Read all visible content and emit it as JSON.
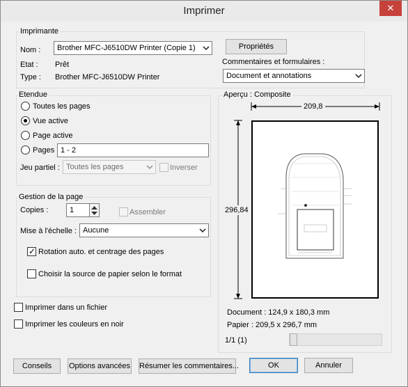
{
  "window": {
    "title": "Imprimer",
    "close_glyph": "✕"
  },
  "printer": {
    "group_label": "Imprimante",
    "name_label": "Nom :",
    "name_value": "Brother MFC-J6510DW Printer (Copie 1)",
    "status_label": "Etat :",
    "status_value": "Prêt",
    "type_label": "Type :",
    "type_value": "Brother MFC-J6510DW Printer",
    "properties_button": "Propriétés",
    "comments_label": "Commentaires et formulaires :",
    "comments_value": "Document et annotations"
  },
  "range": {
    "group_label": "Etendue",
    "all_pages": "Toutes les pages",
    "current_view": "Vue active",
    "current_page": "Page active",
    "pages": "Pages",
    "pages_value": "1 - 2",
    "subset_label": "Jeu partiel :",
    "subset_value": "Toutes les pages",
    "reverse": "Inverser",
    "selected": "current_view"
  },
  "handling": {
    "group_label": "Gestion de la page",
    "copies_label": "Copies :",
    "copies_value": "1",
    "collate": "Assembler",
    "scaling_label": "Mise à l'échelle :",
    "scaling_value": "Aucune",
    "auto_rotate": "Rotation auto. et centrage des pages",
    "auto_rotate_checked": true,
    "paper_source": "Choisir la source de papier selon le format",
    "paper_source_checked": false
  },
  "options": {
    "print_to_file": "Imprimer dans un fichier",
    "print_grayscale": "Imprimer les couleurs en noir"
  },
  "preview": {
    "group_label": "Aperçu : Composite",
    "width": "209,8",
    "height": "296,84",
    "document_size": "Document : 124,9 x 180,3 mm",
    "paper_size": "Papier : 209,5 x 296,7 mm",
    "page_counter": "1/1 (1)",
    "page_position": 0
  },
  "buttons": {
    "tips": "Conseils",
    "advanced": "Options avancées",
    "summarize": "Résumer les commentaires...",
    "ok": "OK",
    "cancel": "Annuler"
  }
}
